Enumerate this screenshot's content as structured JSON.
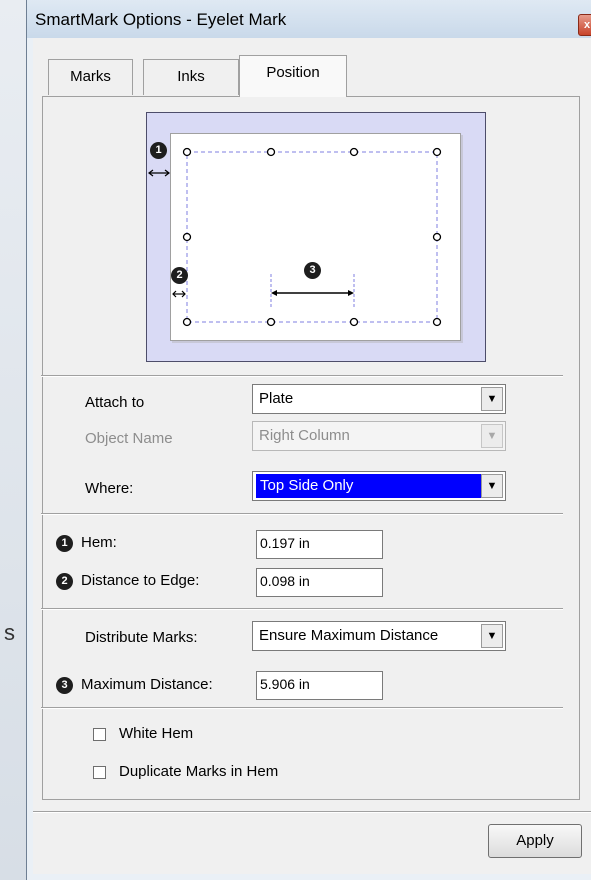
{
  "window": {
    "title": "SmartMark Options - Eyelet Mark",
    "close_glyph": "x"
  },
  "background": {
    "fragment": "s"
  },
  "tabs": [
    {
      "label": "Marks",
      "active": false
    },
    {
      "label": "Inks",
      "active": false
    },
    {
      "label": "Position",
      "active": true
    }
  ],
  "preview": {
    "markers": [
      "1",
      "2",
      "3"
    ],
    "colors": {
      "background": "#d9daf5",
      "guide": "#7f7fe0"
    }
  },
  "fields": {
    "attach_to": {
      "label": "Attach to",
      "value": "Plate"
    },
    "object_name": {
      "label": "Object Name",
      "value": "Right Column"
    },
    "where": {
      "label": "Where:",
      "value": "Top Side Only"
    },
    "hem": {
      "number": "1",
      "label": "Hem:",
      "value": "0.197 in"
    },
    "distance_to_edge": {
      "number": "2",
      "label": "Distance to Edge:",
      "value": "0.098 in"
    },
    "distribute_marks": {
      "label": "Distribute Marks:",
      "value": "Ensure Maximum Distance"
    },
    "maximum_distance": {
      "number": "3",
      "label": "Maximum Distance:",
      "value": "5.906 in"
    }
  },
  "checkboxes": {
    "white_hem": {
      "label": "White Hem",
      "checked": false
    },
    "duplicate_marks": {
      "label": "Duplicate Marks in Hem",
      "checked": false
    }
  },
  "buttons": {
    "apply": "Apply"
  },
  "colors": {
    "selection": "#0000ff",
    "window_frame": "#c9d9ea"
  }
}
